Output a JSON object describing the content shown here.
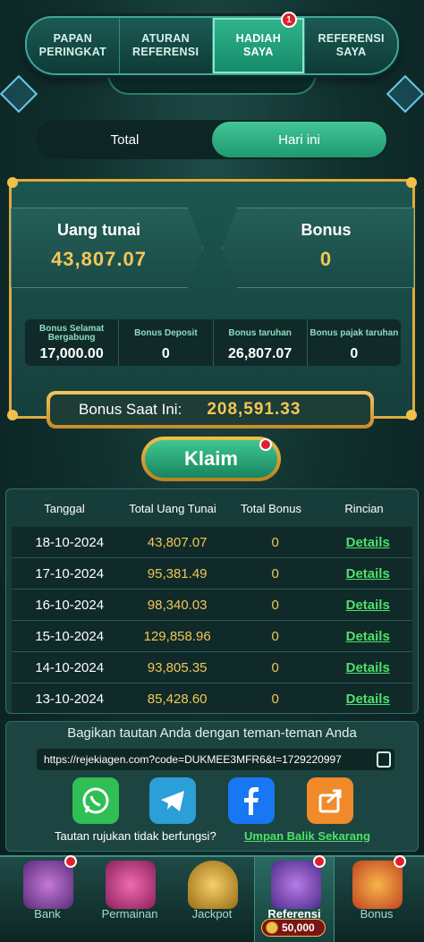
{
  "tabs": [
    {
      "label": "PAPAN\nPERINGKAT"
    },
    {
      "label": "ATURAN\nREFERENSI"
    },
    {
      "label": "HADIAH\nSAYA",
      "badge": "1",
      "active": true
    },
    {
      "label": "REFERENSI\nSAYA"
    }
  ],
  "period": {
    "options": [
      "Total",
      "Hari ini"
    ],
    "selected": "Hari ini"
  },
  "summary": {
    "cash_label": "Uang tunai",
    "cash_value": "43,807.07",
    "bonus_label": "Bonus",
    "bonus_value": "0"
  },
  "stats": [
    {
      "label": "Bonus Selamat Bergabung",
      "value": "17,000.00"
    },
    {
      "label": "Bonus Deposit",
      "value": "0"
    },
    {
      "label": "Bonus taruhan",
      "value": "26,807.07"
    },
    {
      "label": "Bonus pajak taruhan",
      "value": "0"
    }
  ],
  "current_bonus": {
    "label": "Bonus Saat Ini:",
    "value": "208,591.33"
  },
  "claim_label": "Klaim",
  "table": {
    "headers": [
      "Tanggal",
      "Total Uang Tunai",
      "Total Bonus",
      "Rincian"
    ],
    "rows": [
      {
        "date": "18-10-2024",
        "cash": "43,807.07",
        "bonus": "0",
        "link": "Details"
      },
      {
        "date": "17-10-2024",
        "cash": "95,381.49",
        "bonus": "0",
        "link": "Details"
      },
      {
        "date": "16-10-2024",
        "cash": "98,340.03",
        "bonus": "0",
        "link": "Details"
      },
      {
        "date": "15-10-2024",
        "cash": "129,858.96",
        "bonus": "0",
        "link": "Details"
      },
      {
        "date": "14-10-2024",
        "cash": "93,805.35",
        "bonus": "0",
        "link": "Details"
      },
      {
        "date": "13-10-2024",
        "cash": "85,428.60",
        "bonus": "0",
        "link": "Details"
      }
    ]
  },
  "share": {
    "title": "Bagikan tautan Anda dengan teman-teman Anda",
    "link": "https://rejekiagen.com?code=DUKMEE3MFR6&t=1729220997",
    "icons": [
      "whatsapp-icon",
      "telegram-icon",
      "facebook-icon",
      "share-icon"
    ],
    "colors": {
      "whatsapp": "#2fbf55",
      "telegram": "#2a9fd8",
      "facebook": "#1877f2",
      "share": "#f08a2a"
    },
    "note": "Tautan rujukan tidak berfungsi?",
    "feedback": "Umpan Balik Sekarang"
  },
  "bottom_nav": [
    {
      "label": "Bank",
      "badge": "1"
    },
    {
      "label": "Permainan"
    },
    {
      "label": "Jackpot"
    },
    {
      "label": "Referensi",
      "badge": "1",
      "active": true,
      "coins": "50,000"
    },
    {
      "label": "Bonus",
      "badge": "1"
    }
  ]
}
